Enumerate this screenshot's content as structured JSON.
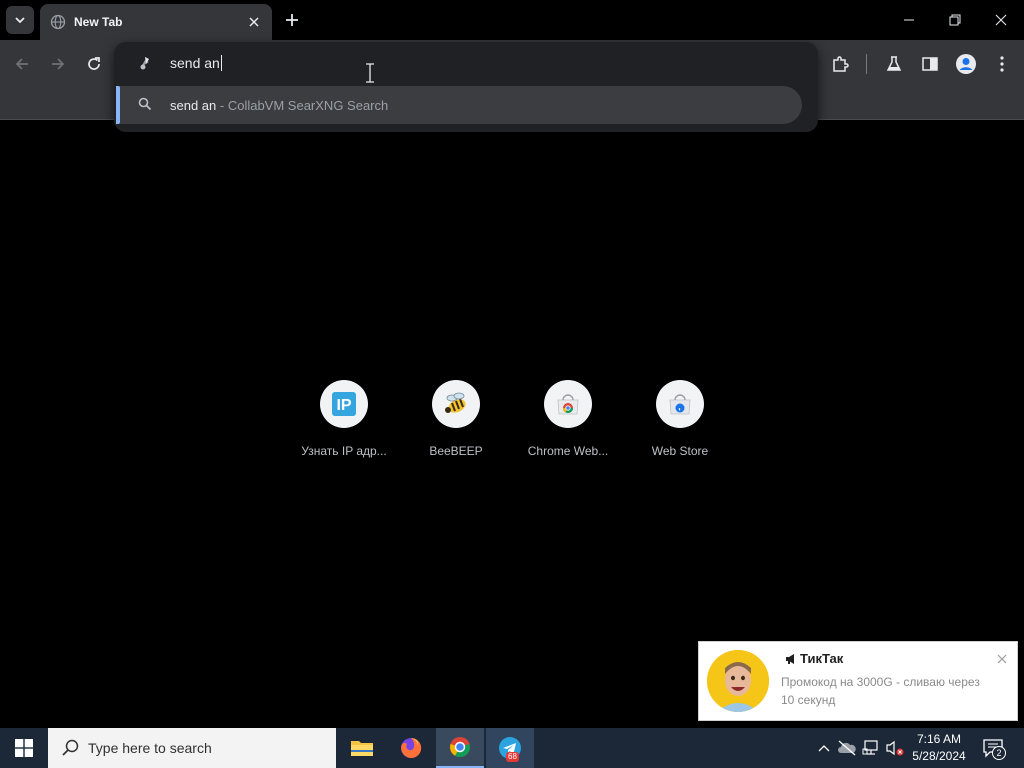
{
  "browser": {
    "tab": {
      "title": "New Tab"
    },
    "omnibox": {
      "input_value": "send an",
      "suggestion": {
        "query": "send an",
        "separator": " - ",
        "engine": "CollabVM SearXNG Search"
      }
    }
  },
  "shortcuts": [
    {
      "label": "Узнать IP адр...",
      "icon": "ip-icon"
    },
    {
      "label": "BeeBEEP",
      "icon": "bee-icon"
    },
    {
      "label": "Chrome Web...",
      "icon": "chrome-web-store-icon"
    },
    {
      "label": "Web Store",
      "icon": "web-store-icon"
    }
  ],
  "notification": {
    "title": "ТикТак",
    "body": "Промокод на 3000G - сливаю через 10 секунд"
  },
  "taskbar": {
    "search_placeholder": "Type here to search",
    "telegram_badge": "68",
    "clock_time": "7:16 AM",
    "clock_date": "5/28/2024",
    "notification_count": "2"
  },
  "colors": {
    "accent": "#8ab4f8",
    "toolbar": "#35363a",
    "taskbar": "#1c2837"
  }
}
